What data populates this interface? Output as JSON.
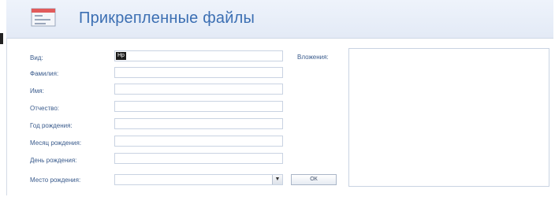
{
  "header": {
    "title": "Прикрепленные файлы"
  },
  "form": {
    "fields": [
      {
        "label": "Вид:",
        "value": "Нр"
      },
      {
        "label": "Фамилия:",
        "value": ""
      },
      {
        "label": "Имя:",
        "value": ""
      },
      {
        "label": "Отчество:",
        "value": ""
      },
      {
        "label": "Год рождения:",
        "value": ""
      },
      {
        "label": "Месяц рождения:",
        "value": ""
      },
      {
        "label": "День рождения:",
        "value": ""
      }
    ],
    "birthplace": {
      "label": "Место рождения:",
      "value": ""
    },
    "birthplace_button": "ОК",
    "attachments_label": "Вложения:"
  },
  "colors": {
    "accent": "#3c6fb3",
    "label": "#3a5b8c",
    "header_bg": "#e3eaf6",
    "border": "#c9d3e2"
  },
  "icons": {
    "form": "form-icon",
    "combo": "chevron-down-icon"
  }
}
